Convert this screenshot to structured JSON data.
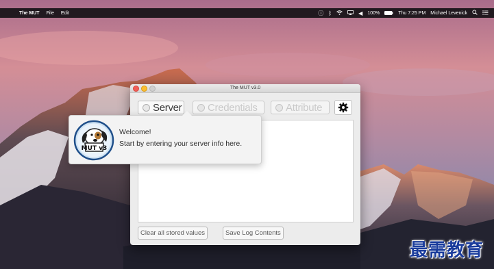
{
  "menubar": {
    "apple": "",
    "app_name": "The MUT",
    "menus": [
      "File",
      "Edit"
    ],
    "battery_percent": "100%",
    "clock": "Thu 7:25 PM",
    "user": "Michael Levenick",
    "icons": [
      "info-icon",
      "bluetooth-icon",
      "wifi-icon",
      "airplay-icon",
      "volume-icon",
      "battery-icon",
      "spotlight-icon",
      "notification-center-icon"
    ]
  },
  "window": {
    "title": "The MUT v3.0",
    "tabs": [
      {
        "label": "Server",
        "state": "active"
      },
      {
        "label": "Credentials",
        "state": "disabled"
      },
      {
        "label": "Attribute",
        "state": "disabled"
      }
    ],
    "buttons": {
      "clear": "Clear all stored values",
      "save_log": "Save Log Contents"
    }
  },
  "popover": {
    "logo_text": "MUT v3",
    "line1": "Welcome!",
    "line2": "Start by entering your server info here."
  },
  "watermark": "最需教育"
}
